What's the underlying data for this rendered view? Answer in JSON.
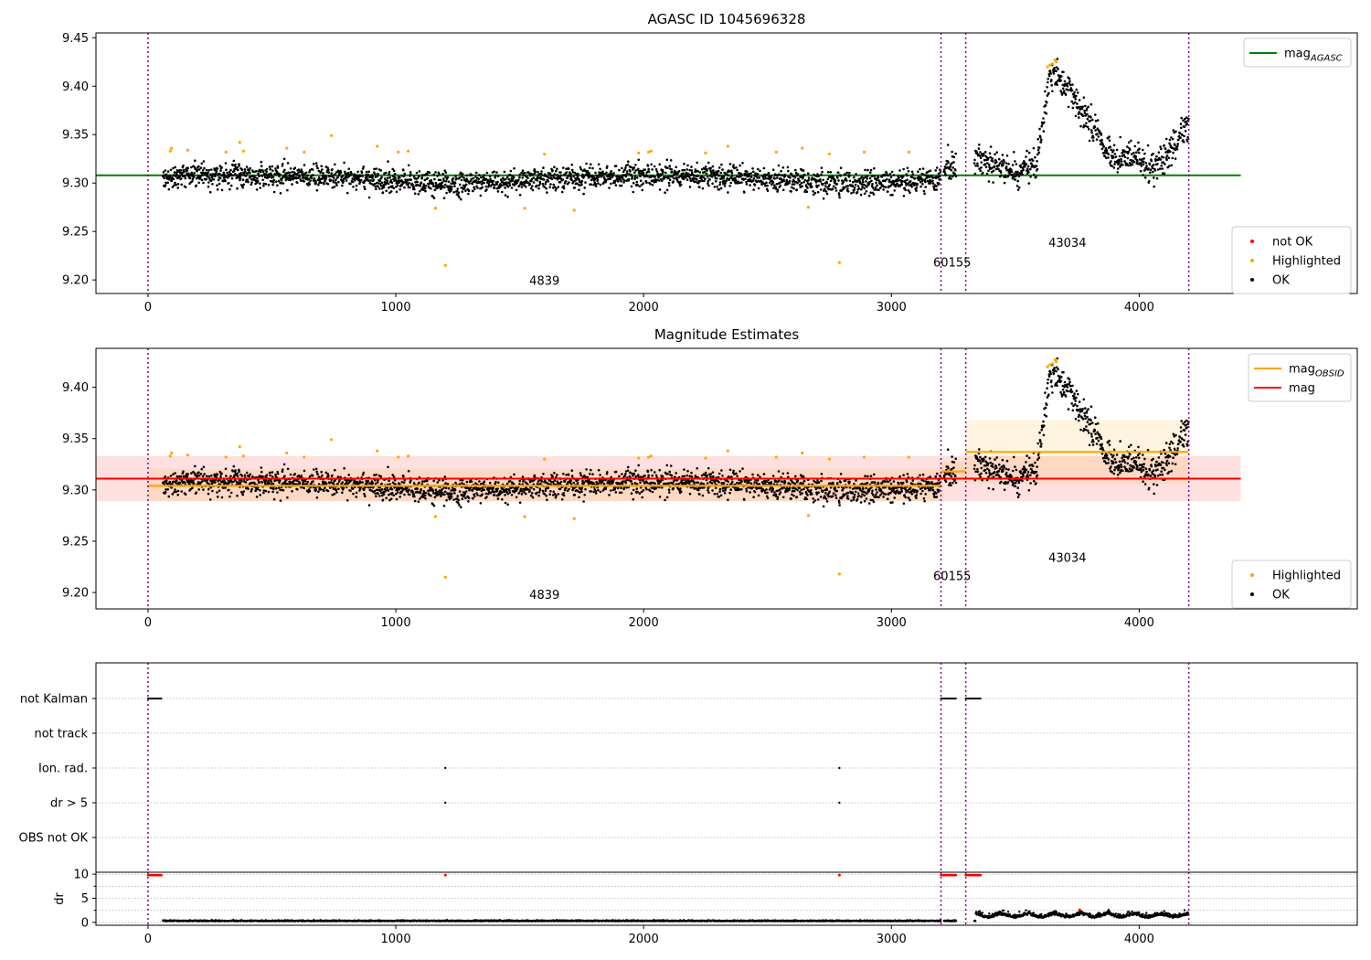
{
  "chart_data": [
    {
      "type": "scatter",
      "title": "AGASC ID 1045696328",
      "xlim": [
        -210,
        4880
      ],
      "ylim": [
        9.186,
        9.455
      ],
      "xticks": [
        0,
        1000,
        2000,
        3000,
        4000
      ],
      "yticks": [
        9.2,
        9.25,
        9.3,
        9.35,
        9.4,
        9.45
      ],
      "grid": false,
      "legend_location": "top-right",
      "legend": [
        {
          "label": "mag",
          "subscript": "AGASC",
          "kind": "line",
          "color": "#008000"
        }
      ],
      "legend_lower": [
        {
          "label": "not OK",
          "kind": "dot",
          "color": "#ff0000"
        },
        {
          "label": "Highlighted",
          "kind": "dot",
          "color": "#ffa500"
        },
        {
          "label": "OK",
          "kind": "dot",
          "color": "#000000"
        }
      ],
      "mag_agasc": 9.308,
      "obsid_boundaries": [
        0,
        3200,
        3300,
        4200
      ],
      "obsid_labels": [
        {
          "text": "4839",
          "x": 1600,
          "y": 9.195
        },
        {
          "text": "60155",
          "x": 3245,
          "y": 9.214
        },
        {
          "text": "43034",
          "x": 3710,
          "y": 9.234
        }
      ],
      "highlighted_points": [
        [
          90,
          9.333
        ],
        [
          95,
          9.336
        ],
        [
          160,
          9.334
        ],
        [
          315,
          9.332
        ],
        [
          370,
          9.342
        ],
        [
          385,
          9.333
        ],
        [
          560,
          9.336
        ],
        [
          630,
          9.332
        ],
        [
          740,
          9.349
        ],
        [
          925,
          9.338
        ],
        [
          1010,
          9.332
        ],
        [
          1050,
          9.333
        ],
        [
          1160,
          9.274
        ],
        [
          1200,
          9.215
        ],
        [
          1520,
          9.274
        ],
        [
          1600,
          9.33
        ],
        [
          1720,
          9.272
        ],
        [
          1980,
          9.331
        ],
        [
          2020,
          9.332
        ],
        [
          2030,
          9.333
        ],
        [
          2250,
          9.331
        ],
        [
          2340,
          9.338
        ],
        [
          2535,
          9.332
        ],
        [
          2640,
          9.336
        ],
        [
          2665,
          9.275
        ],
        [
          2750,
          9.33
        ],
        [
          2790,
          9.218
        ],
        [
          2890,
          9.332
        ],
        [
          3070,
          9.332
        ],
        [
          3630,
          9.42
        ],
        [
          3640,
          9.422
        ],
        [
          3650,
          9.423
        ],
        [
          3660,
          9.427
        ],
        [
          3665,
          9.425
        ]
      ]
    },
    {
      "type": "scatter",
      "title": "Magnitude Estimates",
      "xlim": [
        -210,
        4880
      ],
      "ylim": [
        9.184,
        9.438
      ],
      "xticks": [
        0,
        1000,
        2000,
        3000,
        4000
      ],
      "yticks": [
        9.2,
        9.25,
        9.3,
        9.35,
        9.4
      ],
      "grid": false,
      "legend_location": "top-right",
      "legend": [
        {
          "label": "mag",
          "subscript": "OBSID",
          "kind": "line",
          "color": "#ffa500"
        },
        {
          "label": "mag",
          "subscript": "",
          "kind": "line",
          "color": "#ff0000"
        }
      ],
      "legend_lower": [
        {
          "label": "Highlighted",
          "kind": "dot",
          "color": "#ffa500"
        },
        {
          "label": "OK",
          "kind": "dot",
          "color": "#000000"
        }
      ],
      "mag": 9.311,
      "mag_band": [
        9.289,
        9.333
      ],
      "mag_obsid": [
        {
          "x0": 0,
          "x1": 3200,
          "value": 9.304,
          "band": [
            9.289,
            9.32
          ]
        },
        {
          "x0": 3200,
          "x1": 3300,
          "value": 9.318,
          "band": [
            9.308,
            9.328
          ]
        },
        {
          "x0": 3300,
          "x1": 4200,
          "value": 9.337,
          "band": [
            9.306,
            9.368
          ]
        }
      ],
      "obsid_boundaries": [
        0,
        3200,
        3300,
        4200
      ],
      "obsid_labels": [
        {
          "text": "4839",
          "x": 1600,
          "y": 9.194
        },
        {
          "text": "60155",
          "x": 3245,
          "y": 9.212
        },
        {
          "text": "43034",
          "x": 3710,
          "y": 9.23
        }
      ]
    },
    {
      "type": "scatter",
      "xlim": [
        -210,
        4880
      ],
      "flag_rows": [
        "not Kalman",
        "not track",
        "Ion. rad.",
        "dr > 5",
        "OBS not OK"
      ],
      "flag_ranges": [
        {
          "flag": "not Kalman",
          "ranges": [
            [
              0,
              55
            ],
            [
              3200,
              3260
            ],
            [
              3300,
              3360
            ]
          ]
        },
        {
          "flag": "Ion. rad.",
          "points": [
            1200,
            2790
          ]
        },
        {
          "flag": "dr > 5",
          "points": [
            1200,
            2790
          ]
        }
      ],
      "ylabel": "dr",
      "dr_ylim": [
        -0.6,
        10.4
      ],
      "dr_yticks": [
        0,
        5,
        10
      ],
      "xticks": [
        0,
        1000,
        2000,
        3000,
        4000
      ],
      "obsid_boundaries": [
        0,
        3200,
        3300,
        4200
      ]
    }
  ]
}
